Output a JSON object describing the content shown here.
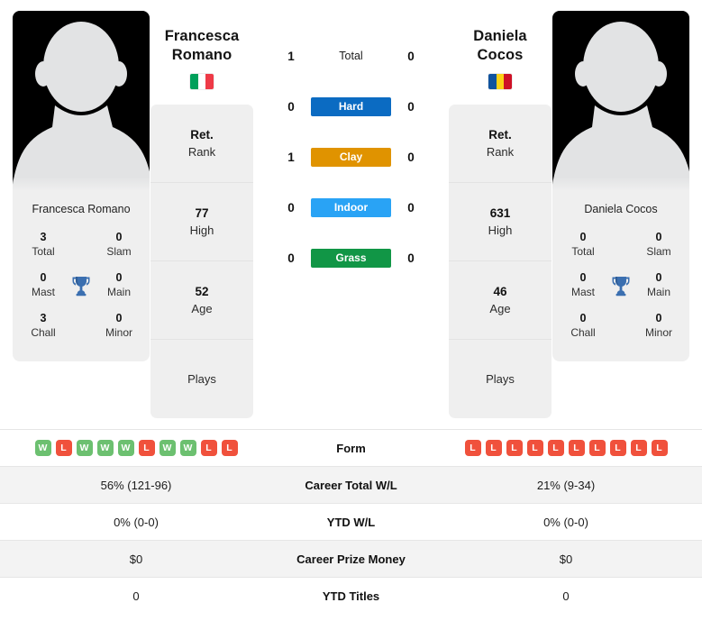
{
  "players": {
    "left": {
      "first_name": "Francesca",
      "last_name": "Romano",
      "full_name": "Francesca Romano",
      "card_name": "Francesca Romano",
      "country": "Italy",
      "flag_colors": [
        "#00a05a",
        "#ffffff",
        "#ee3a47"
      ],
      "titles": {
        "total_value": "3",
        "total_label": "Total",
        "slam_value": "0",
        "slam_label": "Slam",
        "mast_value": "0",
        "mast_label": "Mast",
        "main_value": "0",
        "main_label": "Main",
        "chall_value": "3",
        "chall_label": "Chall",
        "minor_value": "0",
        "minor_label": "Minor"
      },
      "info": [
        {
          "value": "Ret.",
          "label": "Rank"
        },
        {
          "value": "77",
          "label": "High"
        },
        {
          "value": "52",
          "label": "Age"
        },
        {
          "value": "",
          "label": "Plays"
        }
      ],
      "form": [
        "W",
        "L",
        "W",
        "W",
        "W",
        "L",
        "W",
        "W",
        "L",
        "L"
      ],
      "career_total_wl": "56% (121-96)",
      "ytd_wl": "0% (0-0)",
      "career_prize_money": "$0",
      "ytd_titles": "0"
    },
    "right": {
      "first_name": "Daniela",
      "last_name": "Cocos",
      "full_name": "Daniela Cocos",
      "card_name": "Daniela Cocos",
      "country": "Romania",
      "flag_colors": [
        "#11539e",
        "#fcd116",
        "#ce1126"
      ],
      "titles": {
        "total_value": "0",
        "total_label": "Total",
        "slam_value": "0",
        "slam_label": "Slam",
        "mast_value": "0",
        "mast_label": "Mast",
        "main_value": "0",
        "main_label": "Main",
        "chall_value": "0",
        "chall_label": "Chall",
        "minor_value": "0",
        "minor_label": "Minor"
      },
      "info": [
        {
          "value": "Ret.",
          "label": "Rank"
        },
        {
          "value": "631",
          "label": "High"
        },
        {
          "value": "46",
          "label": "Age"
        },
        {
          "value": "",
          "label": "Plays"
        }
      ],
      "form": [
        "L",
        "L",
        "L",
        "L",
        "L",
        "L",
        "L",
        "L",
        "L",
        "L"
      ],
      "career_total_wl": "21% (9-34)",
      "ytd_wl": "0% (0-0)",
      "career_prize_money": "$0",
      "ytd_titles": "0"
    }
  },
  "head_to_head": [
    {
      "label": "Total",
      "left": "1",
      "right": "0",
      "color": "",
      "plain": true
    },
    {
      "label": "Hard",
      "left": "0",
      "right": "0",
      "color": "#0b6bc2",
      "plain": false
    },
    {
      "label": "Clay",
      "left": "1",
      "right": "0",
      "color": "#e09300",
      "plain": false
    },
    {
      "label": "Indoor",
      "left": "0",
      "right": "0",
      "color": "#29a3f5",
      "plain": false
    },
    {
      "label": "Grass",
      "left": "0",
      "right": "0",
      "color": "#119646",
      "plain": false
    }
  ],
  "table_rows": [
    {
      "label": "Form",
      "type": "form",
      "shaded": false
    },
    {
      "label": "Career Total W/L",
      "type": "text",
      "shaded": true,
      "key": "career_total_wl"
    },
    {
      "label": "YTD W/L",
      "type": "text",
      "shaded": false,
      "key": "ytd_wl"
    },
    {
      "label": "Career Prize Money",
      "type": "text",
      "shaded": true,
      "key": "career_prize_money"
    },
    {
      "label": "YTD Titles",
      "type": "text",
      "shaded": false,
      "key": "ytd_titles"
    }
  ],
  "theme": {
    "card_bg": "#efefef",
    "shaded_row_bg": "#f3f3f3",
    "win_badge_color": "#6cc070",
    "loss_badge_color": "#f0513c",
    "trophy_color": "#3b6fb0"
  }
}
